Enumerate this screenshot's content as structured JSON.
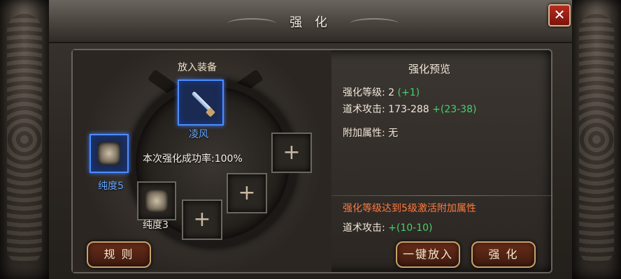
{
  "window": {
    "title": "强 化"
  },
  "left": {
    "put_in_label": "放入装备",
    "equipment_name": "凌风",
    "success_rate_text": "本次强化成功率:100%",
    "material_1_label": "纯度5",
    "material_2_label": "纯度3",
    "buttons": {
      "rules": "规 则"
    }
  },
  "right": {
    "preview_title": "强化预览",
    "stats": {
      "level_label": "强化等级:",
      "level_value": "2",
      "level_bonus": "(+1)",
      "attack_label": "道术攻击:",
      "attack_value": "173-288",
      "attack_bonus": "+(23-38)",
      "extra_label": "附加属性:",
      "extra_value": "无"
    },
    "unlock_text": "强化等级达到5级激活附加属性",
    "unlock_stat_label": "道术攻击:",
    "unlock_stat_value": "+(10-10)",
    "buttons": {
      "one_click": "一键放入",
      "enhance": "强 化"
    }
  },
  "colors": {
    "accent_blue": "#62a6ff",
    "bonus_green": "#47d06b",
    "warning_orange": "#ff7a3f",
    "close_red": "#b62b1e"
  },
  "icons": {
    "close": "close-icon",
    "plus": "plus-icon",
    "equipment": "sword-icon",
    "material": "ore-icon"
  }
}
